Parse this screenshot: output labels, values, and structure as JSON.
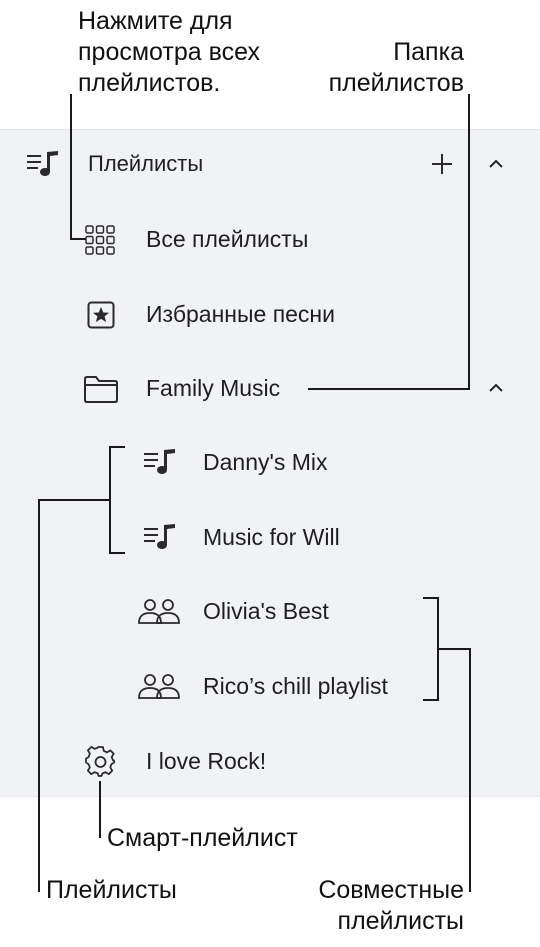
{
  "callouts": {
    "all_playlists_note": [
      "Нажмите для",
      "просмотра всех",
      "плейлистов."
    ],
    "folder_note": [
      "Папка",
      "плейлистов"
    ],
    "smart_playlist": "Смарт-плейлист",
    "playlists": "Плейлисты",
    "shared_playlists": [
      "Совместные",
      "плейлисты"
    ]
  },
  "sidebar": {
    "section_title": "Плейлисты",
    "items": [
      {
        "label": "Все плейлисты",
        "icon": "grid-icon"
      },
      {
        "label": "Избранные песни",
        "icon": "star-square-icon"
      },
      {
        "label": "Family Music",
        "icon": "folder-icon"
      },
      {
        "label": "Danny's Mix",
        "icon": "playlist-icon"
      },
      {
        "label": "Music for Will",
        "icon": "playlist-icon"
      },
      {
        "label": "Olivia's Best",
        "icon": "people-icon"
      },
      {
        "label": "Rico’s chill playlist",
        "icon": "people-icon"
      },
      {
        "label": "I love Rock!",
        "icon": "gear-icon"
      }
    ]
  },
  "colors": {
    "panel_background": "#f1f2f6",
    "text": "#1f1f21",
    "icon": "#2a2a2c",
    "leader_lines": "#1a1a1a"
  }
}
